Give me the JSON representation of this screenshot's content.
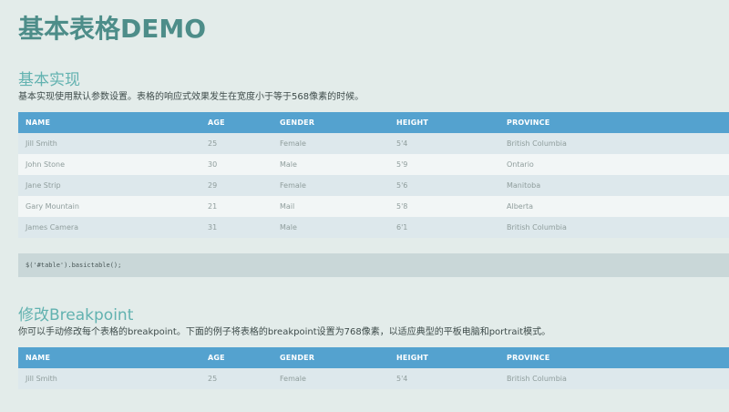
{
  "page": {
    "title": "基本表格DEMO"
  },
  "section1": {
    "heading": "基本实现",
    "description": "基本实现使用默认参数设置。表格的响应式效果发生在宽度小于等于568像素的时候。",
    "code": "$('#table').basictable();"
  },
  "section2": {
    "heading": "修改Breakpoint",
    "description": "你可以手动修改每个表格的breakpoint。下面的例子将表格的breakpoint设置为768像素，以适应典型的平板电脑和portrait模式。"
  },
  "table": {
    "headers": [
      "NAME",
      "AGE",
      "GENDER",
      "HEIGHT",
      "PROVINCE"
    ],
    "rows": [
      [
        "Jill Smith",
        "25",
        "Female",
        "5'4",
        "British Columbia"
      ],
      [
        "John Stone",
        "30",
        "Male",
        "5'9",
        "Ontario"
      ],
      [
        "Jane Strip",
        "29",
        "Female",
        "5'6",
        "Manitoba"
      ],
      [
        "Gary Mountain",
        "21",
        "Mail",
        "5'8",
        "Alberta"
      ],
      [
        "James Camera",
        "31",
        "Male",
        "6'1",
        "British Columbia"
      ]
    ]
  },
  "colors": {
    "title": "#4d8d89",
    "heading": "#62b2b0",
    "table_header": "#54a2cf",
    "background": "#e3ecea"
  }
}
